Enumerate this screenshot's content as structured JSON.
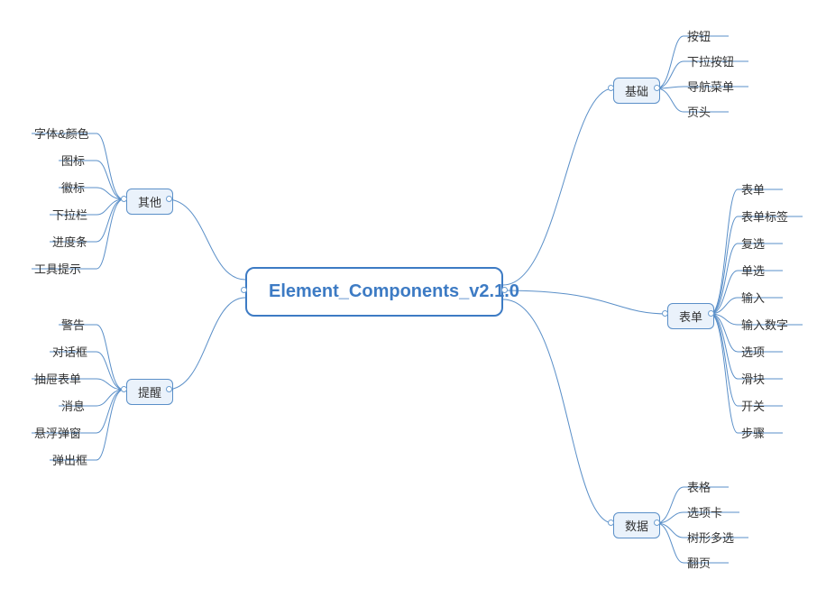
{
  "root": {
    "label": "Element_Components_v2.1.0"
  },
  "branches": {
    "basic": {
      "label": "基础",
      "side": "right",
      "leaves": [
        "按钮",
        "下拉按钮",
        "导航菜单",
        "页头"
      ]
    },
    "form": {
      "label": "表单",
      "side": "right",
      "leaves": [
        "表单",
        "表单标签",
        "复选",
        "单选",
        "输入",
        "输入数字",
        "选项",
        "滑块",
        "开关",
        "步骤"
      ]
    },
    "data": {
      "label": "数据",
      "side": "right",
      "leaves": [
        "表格",
        "选项卡",
        "树形多选",
        "翻页"
      ]
    },
    "other": {
      "label": "其他",
      "side": "left",
      "leaves": [
        "字体&颜色",
        "图标",
        "徽标",
        "下拉栏",
        "进度条",
        "工具提示"
      ]
    },
    "notice": {
      "label": "提醒",
      "side": "left",
      "leaves": [
        "警告",
        "对话框",
        "抽屉表单",
        "消息",
        "悬浮弹窗",
        "弹出框"
      ]
    }
  }
}
